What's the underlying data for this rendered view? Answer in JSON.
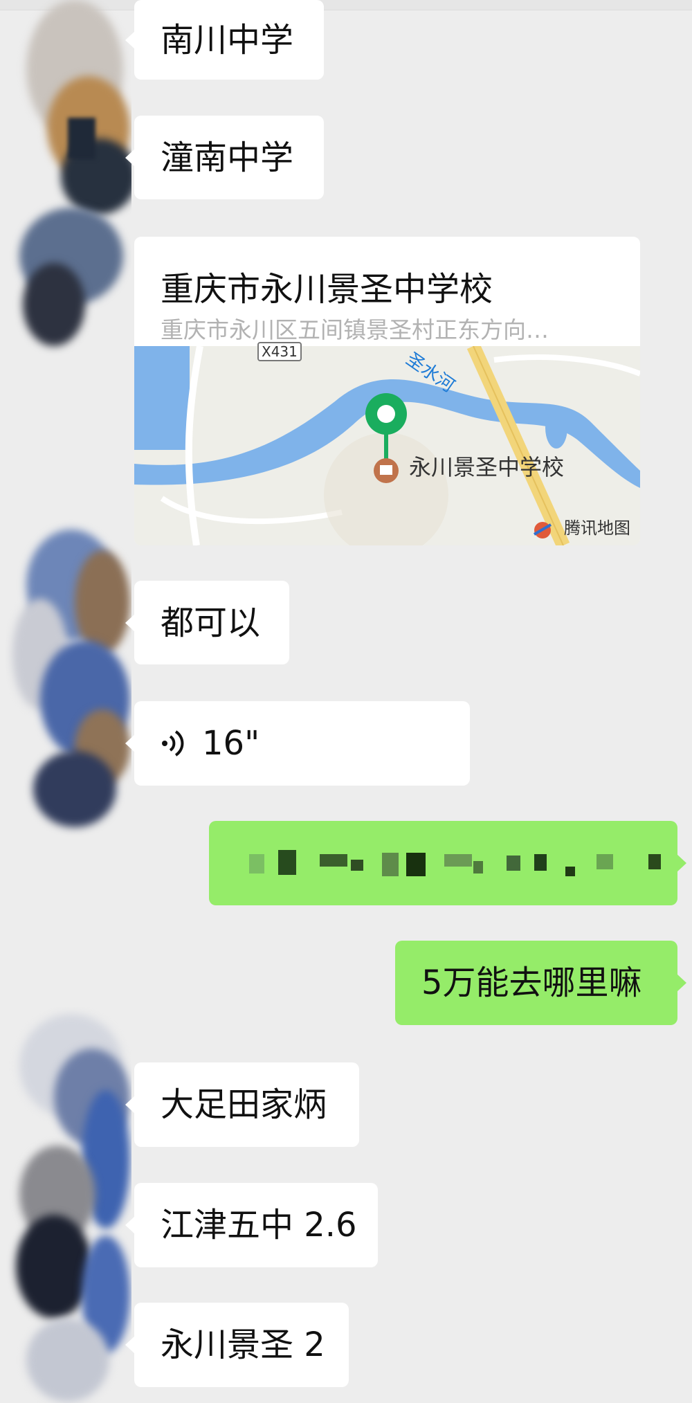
{
  "messages": {
    "m1": "南川中学",
    "m2": "潼南中学",
    "location": {
      "title": "重庆市永川景圣中学校",
      "address": "重庆市永川区五间镇景圣村正东方向…",
      "poi_label": "永川景圣中学校",
      "road_label": "X431",
      "river_label": "圣水河",
      "map_brand": "腾讯地图"
    },
    "m3": "都可以",
    "voice": {
      "duration": "16\"",
      "icon": "voice-wave-icon"
    },
    "m4": "5万能去哪里嘛",
    "m5": "大足田家炳",
    "m6": "江津五中 2.6",
    "m7": "永川景圣 2"
  },
  "colors": {
    "background": "#ededed",
    "incoming_bubble": "#ffffff",
    "outgoing_bubble": "#95ec69",
    "map_pin": "#1aad5e",
    "river": "#7fb3ea"
  }
}
